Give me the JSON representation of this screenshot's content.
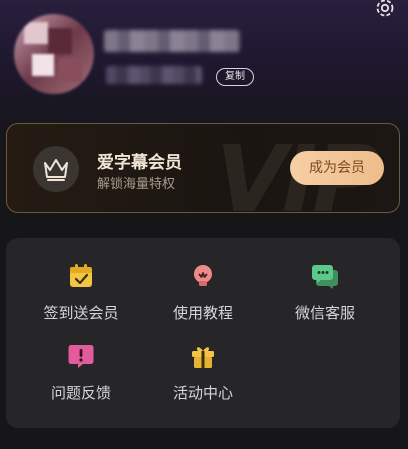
{
  "profile": {
    "copy_label": "复制"
  },
  "vip": {
    "title": "爱字幕会员",
    "subtitle": "解锁海量特权",
    "button_label": "成为会员",
    "watermark": "VIP"
  },
  "menu": {
    "items": [
      {
        "label": "签到送会员",
        "icon": "calendar-check-icon"
      },
      {
        "label": "使用教程",
        "icon": "lightbulb-icon"
      },
      {
        "label": "微信客服",
        "icon": "chat-bubbles-icon"
      },
      {
        "label": "问题反馈",
        "icon": "feedback-exclamation-icon"
      },
      {
        "label": "活动中心",
        "icon": "gift-icon"
      }
    ]
  },
  "colors": {
    "accent_gold": "#F0C08E",
    "icon_yellow": "#F4C542",
    "icon_pink": "#F08A8A",
    "icon_green": "#5CC98A",
    "icon_magenta": "#E25B9A"
  }
}
